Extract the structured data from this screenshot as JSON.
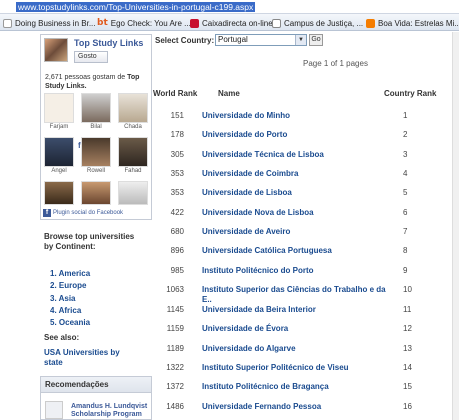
{
  "browser": {
    "url": "www.topstudylinks.com/Top-Universities-in-portugal-c199.aspx",
    "favorites": [
      {
        "label": "Doing Business in Br...",
        "icon": "site-icon"
      },
      {
        "label": "Ego Check: You Are ...",
        "icon": "bt-logo-icon"
      },
      {
        "label": "Caixadirecta on-line",
        "icon": "bank-icon"
      },
      {
        "label": "Campus de Justiça, ...",
        "icon": "page-icon"
      },
      {
        "label": "Boa Vida: Estrelas Mi...",
        "icon": "blog-icon"
      }
    ]
  },
  "facebook": {
    "page_title": "Top Study Links",
    "like_label": "Gosto",
    "count_text": "2,671 pessoas gostam de",
    "count_page": "Top Study Links.",
    "faces": [
      "Farjam",
      "Bilal",
      "Chada",
      "Angel",
      "Rowell",
      "Fahad",
      "",
      "",
      ""
    ],
    "plugin_label": "Plugin social do Facebook"
  },
  "sidebar": {
    "browse_heading": "Browse top universities by Continent:",
    "continents": [
      "1. America",
      "2. Europe",
      "3. Asia",
      "4. Africa",
      "5. Oceania"
    ],
    "see_also": "See also:",
    "usa_link": "USA Universities by state"
  },
  "recommendations": {
    "heading": "Recomendações",
    "item": "Amandus H. Lundqvist",
    "item_sub": "Scholarship Program"
  },
  "filter": {
    "label": "Select Country:",
    "selected": "Portugal",
    "go_label": "Go"
  },
  "pagination": "Page 1 of 1 pages",
  "table": {
    "headers": {
      "world_rank": "World Rank",
      "name": "Name",
      "country_rank": "Country Rank"
    },
    "rows": [
      {
        "world": "151",
        "name": "Universidade do Minho",
        "country": "1"
      },
      {
        "world": "178",
        "name": "Universidade do Porto",
        "country": "2"
      },
      {
        "world": "305",
        "name": "Universidade Técnica de Lisboa",
        "country": "3"
      },
      {
        "world": "353",
        "name": "Universidade de Coimbra",
        "country": "4"
      },
      {
        "world": "353",
        "name": "Universidade de Lisboa",
        "country": "5"
      },
      {
        "world": "422",
        "name": "Universidade Nova de Lisboa",
        "country": "6"
      },
      {
        "world": "680",
        "name": "Universidade de Aveiro",
        "country": "7"
      },
      {
        "world": "896",
        "name": "Universidade Católica Portuguesa",
        "country": "8"
      },
      {
        "world": "985",
        "name": "Instituto Politécnico do Porto",
        "country": "9"
      },
      {
        "world": "1063",
        "name": "Instituto Superior das Ciências do Trabalho e da E..",
        "country": "10"
      },
      {
        "world": "1145",
        "name": "Universidade da Beira Interior",
        "country": "11"
      },
      {
        "world": "1159",
        "name": "Universidade de Évora",
        "country": "12"
      },
      {
        "world": "1189",
        "name": "Universidade do Algarve",
        "country": "13"
      },
      {
        "world": "1322",
        "name": "Instituto Superior Politécnico de Viseu",
        "country": "14"
      },
      {
        "world": "1372",
        "name": "Instituto Politécnico de Bragança",
        "country": "15"
      },
      {
        "world": "1486",
        "name": "Universidade Fernando Pessoa",
        "country": "16"
      }
    ]
  }
}
